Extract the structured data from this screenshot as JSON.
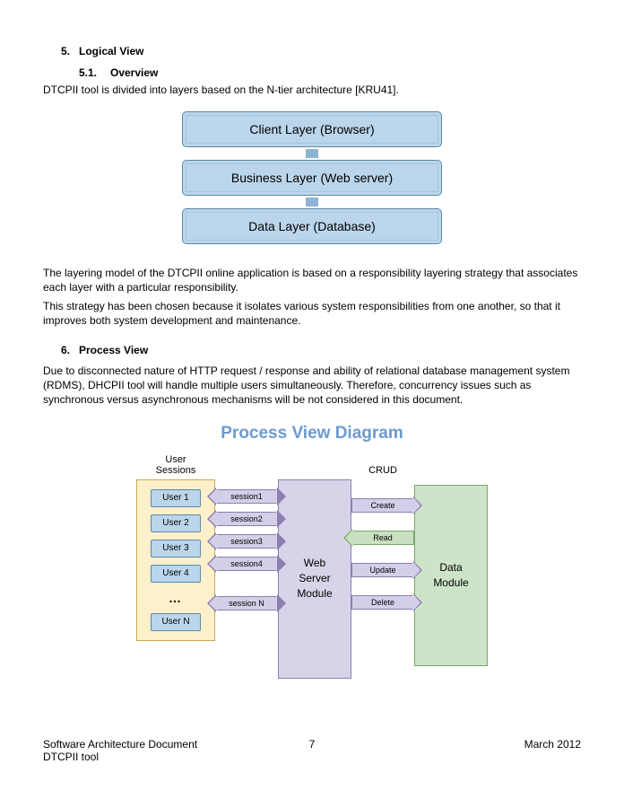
{
  "section5": {
    "num": "5.",
    "title": "Logical View",
    "sub": {
      "num": "5.1.",
      "title": "Overview"
    },
    "intro": "DTCPII tool is divided into layers based on the N-tier architecture [KRU41].",
    "layers": [
      "Client Layer (Browser)",
      "Business Layer (Web server)",
      "Data Layer (Database)"
    ],
    "para1": "The layering model of the DTCPII online application is based on a responsibility layering strategy that associates each layer with a particular responsibility.",
    "para2": "This strategy has been chosen because it isolates various system responsibilities from one another, so that it improves both system development and maintenance."
  },
  "section6": {
    "num": "6.",
    "title": "Process View",
    "para": "Due to disconnected nature of HTTP request / response and ability of relational database management system (RDMS), DHCPII tool will handle multiple users simultaneously. Therefore, concurrency issues such as synchronous versus asynchronous mechanisms will be not considered in this document.",
    "diagramTitle": "Process View Diagram",
    "userSessionsLabel": "User\nSessions",
    "crudLabel": "CRUD",
    "users": [
      "User 1",
      "User 2",
      "User 3",
      "User 4",
      "User N"
    ],
    "dots": "…",
    "sessions": [
      "session1",
      "session2",
      "session3",
      "session4",
      "session N"
    ],
    "webServer": "Web\nServer\nModule",
    "crud": [
      "Create",
      "Read",
      "Update",
      "Delete"
    ],
    "dataModule": "Data\nModule"
  },
  "footer": {
    "left1": "Software Architecture Document",
    "left2": "DTCPII tool",
    "page": "7",
    "date": "March 2012"
  }
}
